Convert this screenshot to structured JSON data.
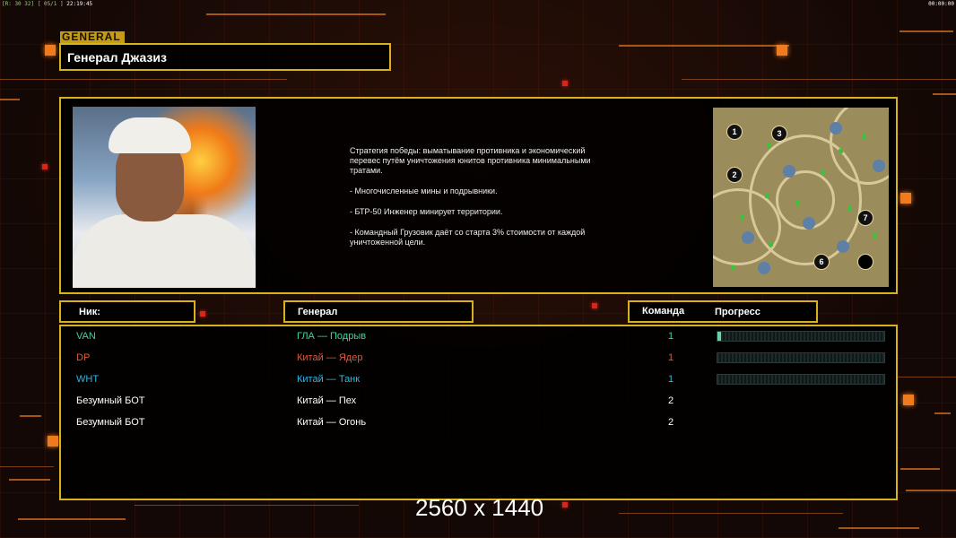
{
  "hud": {
    "status_text": "[R: 30 32] [ 05/1 ]",
    "time_left": "22:19:45",
    "time_right": "00:00:00"
  },
  "header": {
    "tag": "GENERAL",
    "general_name": "Генерал Джазиз"
  },
  "info": {
    "victory_text": [
      "Стратегия победы: выматывание противника и экономический\n перевес путём уничтожения юнитов противника минимальными\n тратами.",
      "- Многочисленные мины и подрывники.",
      "- БТР-50 Инженер минирует территории.",
      "- Командный Грузовик даёт со старта 3% стоимости от каждой\n уничтоженной цели."
    ],
    "map_slots": [
      "1",
      "3",
      "2",
      "7",
      "6",
      ""
    ]
  },
  "columns": {
    "nick": "Ник:",
    "general": "Генерал",
    "team": "Команда",
    "progress": "Прогресс"
  },
  "players": [
    {
      "nick": "VAN",
      "general": "ГЛА — Подрыв",
      "team": "1",
      "progress": 0.02,
      "has_bar": true,
      "color": "#3fd79a"
    },
    {
      "nick": "DP",
      "general": "Китай — Ядер",
      "team": "1",
      "progress": 0,
      "has_bar": true,
      "color": "#e05a3a"
    },
    {
      "nick": "WHT",
      "general": "Китай — Танк",
      "team": "1",
      "progress": 0,
      "has_bar": true,
      "color": "#2fb7e8"
    },
    {
      "nick": "Безумный БОТ",
      "general": "Китай — Пех",
      "team": "2",
      "progress": 0,
      "has_bar": false,
      "color": "#ffffff"
    },
    {
      "nick": "Безумный БОТ",
      "general": "Китай — Огонь",
      "team": "2",
      "progress": 0,
      "has_bar": false,
      "color": "#ffffff"
    }
  ],
  "overlay": {
    "resolution": "2560 x 1440"
  },
  "colors": {
    "frame": "#d8b21c",
    "accent": "#f07a1e"
  }
}
